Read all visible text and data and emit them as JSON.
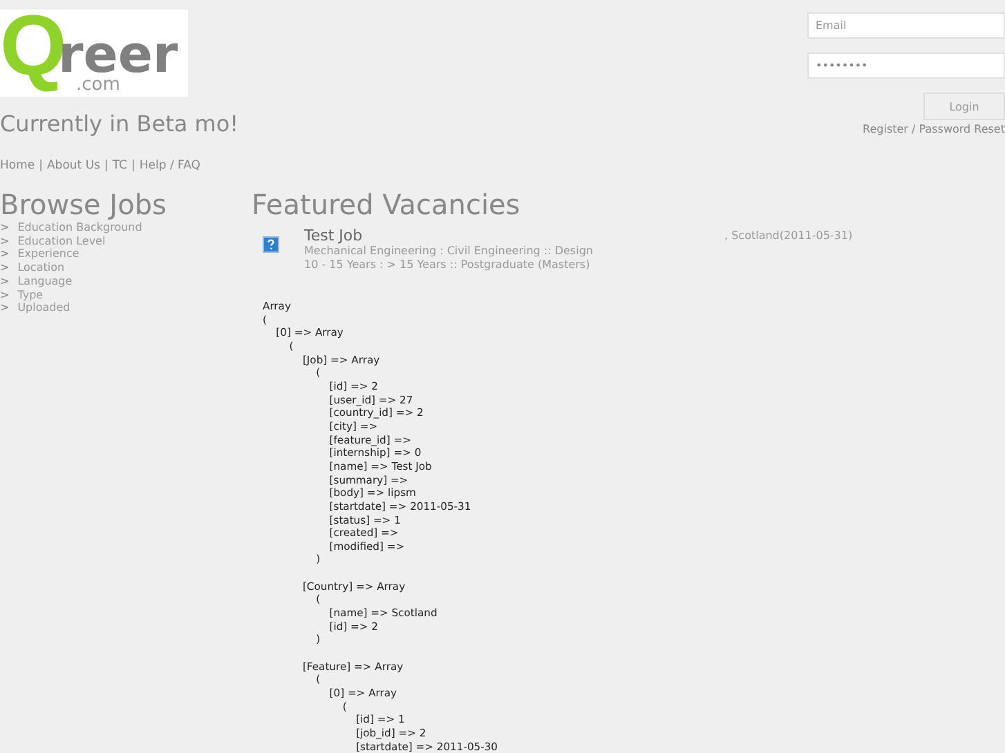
{
  "logo": {
    "letter": "Q",
    "rest": "reer",
    "suffix": ".com"
  },
  "tagline": "Currently in Beta mo!",
  "nav": [
    "Home",
    "About Us",
    "TC",
    "Help / FAQ"
  ],
  "nav_separator": "|",
  "login": {
    "email_placeholder": "Email",
    "password_value": "••••••••",
    "button": "Login",
    "links": "Register / Password Reset"
  },
  "sidebar": {
    "title": "Browse Jobs",
    "marker": ">",
    "items": [
      "Education Background",
      "Education Level",
      "Experience",
      "Location",
      "Language",
      "Type",
      "Uploaded"
    ]
  },
  "main": {
    "title": "Featured Vacancies",
    "jobs": [
      {
        "title": "Test Job",
        "line_1": "Mechanical Engineering : Civil Engineering :: Design",
        "line_2": "10 - 15 Years : > 15 Years :: Postgraduate (Masters)",
        "location": ", Scotland(2011-05-31)"
      }
    ],
    "debug_dump": "Array\n(\n    [0] => Array\n        (\n            [Job] => Array\n                (\n                    [id] => 2\n                    [user_id] => 27\n                    [country_id] => 2\n                    [city] => \n                    [feature_id] => \n                    [internship] => 0\n                    [name] => Test Job\n                    [summary] => \n                    [body] => lipsm\n                    [startdate] => 2011-05-31\n                    [status] => 1\n                    [created] => \n                    [modified] => \n                )\n\n            [Country] => Array\n                (\n                    [name] => Scotland\n                    [id] => 2\n                )\n\n            [Feature] => Array\n                (\n                    [0] => Array\n                        (\n                            [id] => 1\n                            [job_id] => 2\n                            [startdate] => 2011-05-30"
  }
}
